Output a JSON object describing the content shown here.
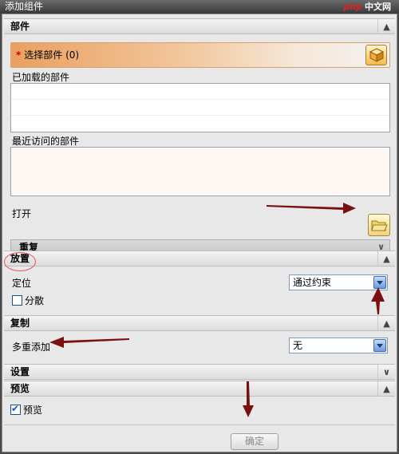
{
  "window": {
    "title": "添加组件"
  },
  "watermark": {
    "brand": "php",
    "text": "中文网"
  },
  "parts_section": {
    "heading": "部件",
    "select_label": "选择部件 (0)",
    "required_mark": "*",
    "loaded_label": "已加载的部件",
    "recent_label": "最近访问的部件",
    "open_label": "打开",
    "repeat_label": "重复"
  },
  "placement_section": {
    "heading": "放置",
    "position_label": "定位",
    "position_value": "通过约束",
    "scatter_label": "分散"
  },
  "copy_section": {
    "heading": "复制",
    "multi_add_label": "多重添加",
    "multi_add_value": "无"
  },
  "settings_section": {
    "heading": "设置"
  },
  "preview_section": {
    "heading": "预览",
    "preview_label": "预览"
  },
  "footer": {
    "ok_label": "确定"
  },
  "colors": {
    "accent_orange": "#e9a060",
    "arrow_red": "#7a1010",
    "highlight_circle": "#e05a5a"
  },
  "icons": {
    "collapse": "chevron-up-icon",
    "expand": "chevron-down-icon",
    "select_part": "cube-icon",
    "open": "folder-open-icon"
  }
}
